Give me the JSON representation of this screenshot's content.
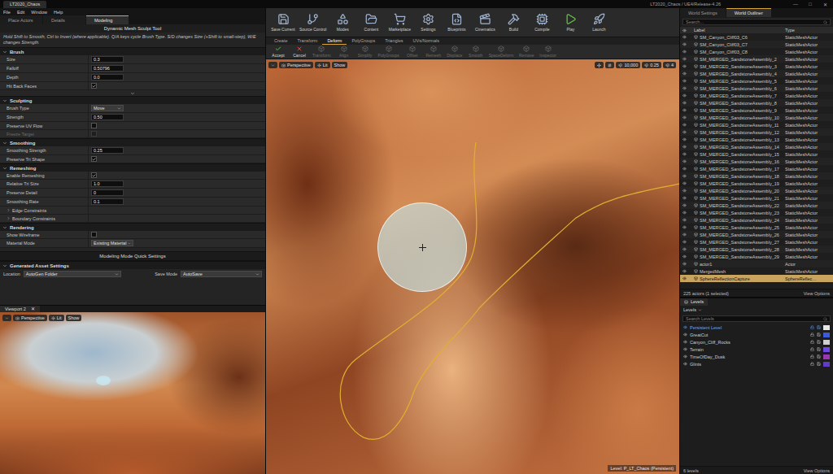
{
  "window": {
    "tab": "LT2020_Chaos",
    "title": "LT2020_Chaos / UE4/Release-4.26",
    "controls": [
      "—",
      "□",
      "✕"
    ]
  },
  "menu": [
    "File",
    "Edit",
    "Window",
    "Help"
  ],
  "left_tabs": [
    {
      "label": "Place Actors",
      "selected": false
    },
    {
      "label": "Details",
      "selected": false
    },
    {
      "label": "Modeling",
      "selected": true
    }
  ],
  "tool": {
    "title": "Dynamic Mesh Sculpt Tool",
    "help": "Hold Shift to Smooth, Ctrl to Invert (where applicable). Q/A keys cycle Brush Type. S/D changes Size (+Shift to small-step), W/E changes Strength."
  },
  "sections": [
    {
      "title": "Brush",
      "expanded": true,
      "advanced": true,
      "rows": [
        {
          "kind": "number",
          "label": "Size",
          "value": "0.3",
          "disabled": false
        },
        {
          "kind": "number",
          "label": "Falloff",
          "value": "0.50796",
          "disabled": false
        },
        {
          "kind": "number",
          "label": "Depth",
          "value": "0.0",
          "disabled": false
        },
        {
          "kind": "check",
          "label": "Hit Back Faces",
          "checked": true,
          "disabled": false
        }
      ]
    },
    {
      "title": "Sculpting",
      "expanded": true,
      "advanced": false,
      "rows": [
        {
          "kind": "dropdown",
          "label": "Brush Type",
          "value": "Move",
          "disabled": false
        },
        {
          "kind": "number",
          "label": "Strength",
          "value": "0.50",
          "disabled": false
        },
        {
          "kind": "check",
          "label": "Preserve UV Flow",
          "checked": false,
          "disabled": false
        },
        {
          "kind": "check",
          "label": "Freeze Target",
          "checked": false,
          "disabled": true
        }
      ]
    },
    {
      "title": "Smoothing",
      "expanded": true,
      "advanced": false,
      "rows": [
        {
          "kind": "number",
          "label": "Smoothing Strength",
          "value": "0.25",
          "disabled": false
        },
        {
          "kind": "check",
          "label": "Preserve Tri Shape",
          "checked": true,
          "disabled": false
        }
      ]
    },
    {
      "title": "Remeshing",
      "expanded": true,
      "advanced": false,
      "rows": [
        {
          "kind": "check",
          "label": "Enable Remeshing",
          "checked": true,
          "disabled": false
        },
        {
          "kind": "number",
          "label": "Relative Tri Size",
          "value": "1.0",
          "disabled": false
        },
        {
          "kind": "number",
          "label": "Preserve Detail",
          "value": "0",
          "disabled": false
        },
        {
          "kind": "number",
          "label": "Smoothing Rate",
          "value": "0.1",
          "disabled": false
        },
        {
          "kind": "group",
          "label": "Edge Constraints",
          "expanded": false,
          "disabled": false
        },
        {
          "kind": "group",
          "label": "Boundary Constraints",
          "expanded": false,
          "disabled": false
        }
      ]
    },
    {
      "title": "Rendering",
      "expanded": true,
      "advanced": false,
      "rows": [
        {
          "kind": "check",
          "label": "Show Wireframe",
          "checked": false,
          "disabled": false
        },
        {
          "kind": "dropdown",
          "label": "Material Mode",
          "value": "Existing Material",
          "disabled": false
        }
      ]
    }
  ],
  "quick_settings": "Modeling Mode Quick Settings",
  "asset_settings": {
    "title": "Generated Asset Settings",
    "location_label": "Location",
    "location": "AutoGen Folder",
    "save_label": "Save Mode",
    "save": "AutoSave"
  },
  "small_viewport": {
    "tab": "Viewport 2",
    "close": "✕",
    "view": "Perspective",
    "lighting": "Lit",
    "show": "Show"
  },
  "toolbar": [
    "Save Current",
    "Source Control",
    "Modes",
    "Content",
    "Marketplace",
    "Settings",
    "Blueprints",
    "Cinematics",
    "Build",
    "Compile",
    "Play",
    "Launch"
  ],
  "modeling_tabs": [
    {
      "label": "Create",
      "selected": false
    },
    {
      "label": "Transform",
      "selected": false
    },
    {
      "label": "Deform",
      "selected": true
    },
    {
      "label": "PolyGroups",
      "selected": false
    },
    {
      "label": "Triangles",
      "selected": false
    },
    {
      "label": "UVs/Normals",
      "selected": false
    }
  ],
  "modeling_buttons": [
    {
      "kind": "accept",
      "label": "Accept",
      "disabled": false
    },
    {
      "kind": "cancel",
      "label": "Cancel",
      "disabled": false
    },
    {
      "kind": "tool",
      "label": "Transform",
      "disabled": true
    },
    {
      "kind": "tool",
      "label": "Align",
      "disabled": true
    },
    {
      "kind": "tool",
      "label": "Simplify",
      "disabled": true
    },
    {
      "kind": "tool",
      "label": "PolyGroups",
      "disabled": true
    },
    {
      "kind": "tool",
      "label": "Offset",
      "disabled": true
    },
    {
      "kind": "tool",
      "label": "Remesh",
      "disabled": true
    },
    {
      "kind": "tool",
      "label": "Displace",
      "disabled": true
    },
    {
      "kind": "tool",
      "label": "Smooth",
      "disabled": true
    },
    {
      "kind": "tool",
      "label": "SpaceDeform",
      "disabled": true
    },
    {
      "kind": "tool",
      "label": "Remove",
      "disabled": true
    },
    {
      "kind": "tool",
      "label": "Inspector",
      "disabled": true
    }
  ],
  "viewport": {
    "view": "Perspective",
    "lighting": "Lit",
    "show": "Show",
    "snap_values": [
      "10,000",
      "0.25",
      "4"
    ],
    "level": "Level: P_LT_Chaos (Persistent)"
  },
  "outliner": {
    "tabs": [
      {
        "label": "World Settings",
        "selected": false
      },
      {
        "label": "World Outliner",
        "selected": true
      }
    ],
    "search": "Search...",
    "columns": [
      "Label",
      "Type"
    ],
    "rows": [
      {
        "label": "SM_Canyon_Cliff03_C6",
        "type": "StaticMeshActor",
        "selected": false
      },
      {
        "label": "SM_Canyon_Cliff03_C7",
        "type": "StaticMeshActor",
        "selected": false
      },
      {
        "label": "SM_Canyon_Cliff03_C8",
        "type": "StaticMeshActor",
        "selected": false
      },
      {
        "label": "SM_MERGED_SandstoneAssembly_2",
        "type": "StaticMeshActor",
        "selected": false
      },
      {
        "label": "SM_MERGED_SandstoneAssembly_3",
        "type": "StaticMeshActor",
        "selected": false
      },
      {
        "label": "SM_MERGED_SandstoneAssembly_4",
        "type": "StaticMeshActor",
        "selected": false
      },
      {
        "label": "SM_MERGED_SandstoneAssembly_5",
        "type": "StaticMeshActor",
        "selected": false
      },
      {
        "label": "SM_MERGED_SandstoneAssembly_6",
        "type": "StaticMeshActor",
        "selected": false
      },
      {
        "label": "SM_MERGED_SandstoneAssembly_7",
        "type": "StaticMeshActor",
        "selected": false
      },
      {
        "label": "SM_MERGED_SandstoneAssembly_8",
        "type": "StaticMeshActor",
        "selected": false
      },
      {
        "label": "SM_MERGED_SandstoneAssembly_9",
        "type": "StaticMeshActor",
        "selected": false
      },
      {
        "label": "SM_MERGED_SandstoneAssembly_10",
        "type": "StaticMeshActor",
        "selected": false
      },
      {
        "label": "SM_MERGED_SandstoneAssembly_11",
        "type": "StaticMeshActor",
        "selected": false
      },
      {
        "label": "SM_MERGED_SandstoneAssembly_12",
        "type": "StaticMeshActor",
        "selected": false
      },
      {
        "label": "SM_MERGED_SandstoneAssembly_13",
        "type": "StaticMeshActor",
        "selected": false
      },
      {
        "label": "SM_MERGED_SandstoneAssembly_14",
        "type": "StaticMeshActor",
        "selected": false
      },
      {
        "label": "SM_MERGED_SandstoneAssembly_15",
        "type": "StaticMeshActor",
        "selected": false
      },
      {
        "label": "SM_MERGED_SandstoneAssembly_16",
        "type": "StaticMeshActor",
        "selected": false
      },
      {
        "label": "SM_MERGED_SandstoneAssembly_17",
        "type": "StaticMeshActor",
        "selected": false
      },
      {
        "label": "SM_MERGED_SandstoneAssembly_18",
        "type": "StaticMeshActor",
        "selected": false
      },
      {
        "label": "SM_MERGED_SandstoneAssembly_19",
        "type": "StaticMeshActor",
        "selected": false
      },
      {
        "label": "SM_MERGED_SandstoneAssembly_20",
        "type": "StaticMeshActor",
        "selected": false
      },
      {
        "label": "SM_MERGED_SandstoneAssembly_21",
        "type": "StaticMeshActor",
        "selected": false
      },
      {
        "label": "SM_MERGED_SandstoneAssembly_22",
        "type": "StaticMeshActor",
        "selected": false
      },
      {
        "label": "SM_MERGED_SandstoneAssembly_23",
        "type": "StaticMeshActor",
        "selected": false
      },
      {
        "label": "SM_MERGED_SandstoneAssembly_24",
        "type": "StaticMeshActor",
        "selected": false
      },
      {
        "label": "SM_MERGED_SandstoneAssembly_25",
        "type": "StaticMeshActor",
        "selected": false
      },
      {
        "label": "SM_MERGED_SandstoneAssembly_26",
        "type": "StaticMeshActor",
        "selected": false
      },
      {
        "label": "SM_MERGED_SandstoneAssembly_27",
        "type": "StaticMeshActor",
        "selected": false
      },
      {
        "label": "SM_MERGED_SandstoneAssembly_28",
        "type": "StaticMeshActor",
        "selected": false
      },
      {
        "label": "SM_MERGED_SandstoneAssembly_29",
        "type": "StaticMeshActor",
        "selected": false
      },
      {
        "label": "actor1",
        "type": "Actor",
        "selected": false
      },
      {
        "label": "MergedMesh",
        "type": "StaticMeshActor",
        "selected": false
      },
      {
        "label": "SphereReflectionCapture",
        "type": "SphereReflec…",
        "selected": true
      }
    ],
    "footer": "225 actors (1 selected)",
    "view_options": "View Options"
  },
  "levels": {
    "title": "Levels",
    "menu": "Levels",
    "search": "Search Levels",
    "rows": [
      {
        "name": "Persistent Level",
        "current": true,
        "color": "#e6e6e6"
      },
      {
        "name": "GreatCut",
        "current": false,
        "color": "#3b5bdb"
      },
      {
        "name": "Canyon_Cliff_Rocks",
        "current": false,
        "color": "#cfcfcf"
      },
      {
        "name": "Terrain",
        "current": false,
        "color": "#7048e8"
      },
      {
        "name": "TimeOfDay_Dusk",
        "current": false,
        "color": "#9c36b5"
      },
      {
        "name": "Glints",
        "current": false,
        "color": "#5f3dc4"
      }
    ],
    "footer": "6 levels",
    "view_options": "View Options"
  }
}
